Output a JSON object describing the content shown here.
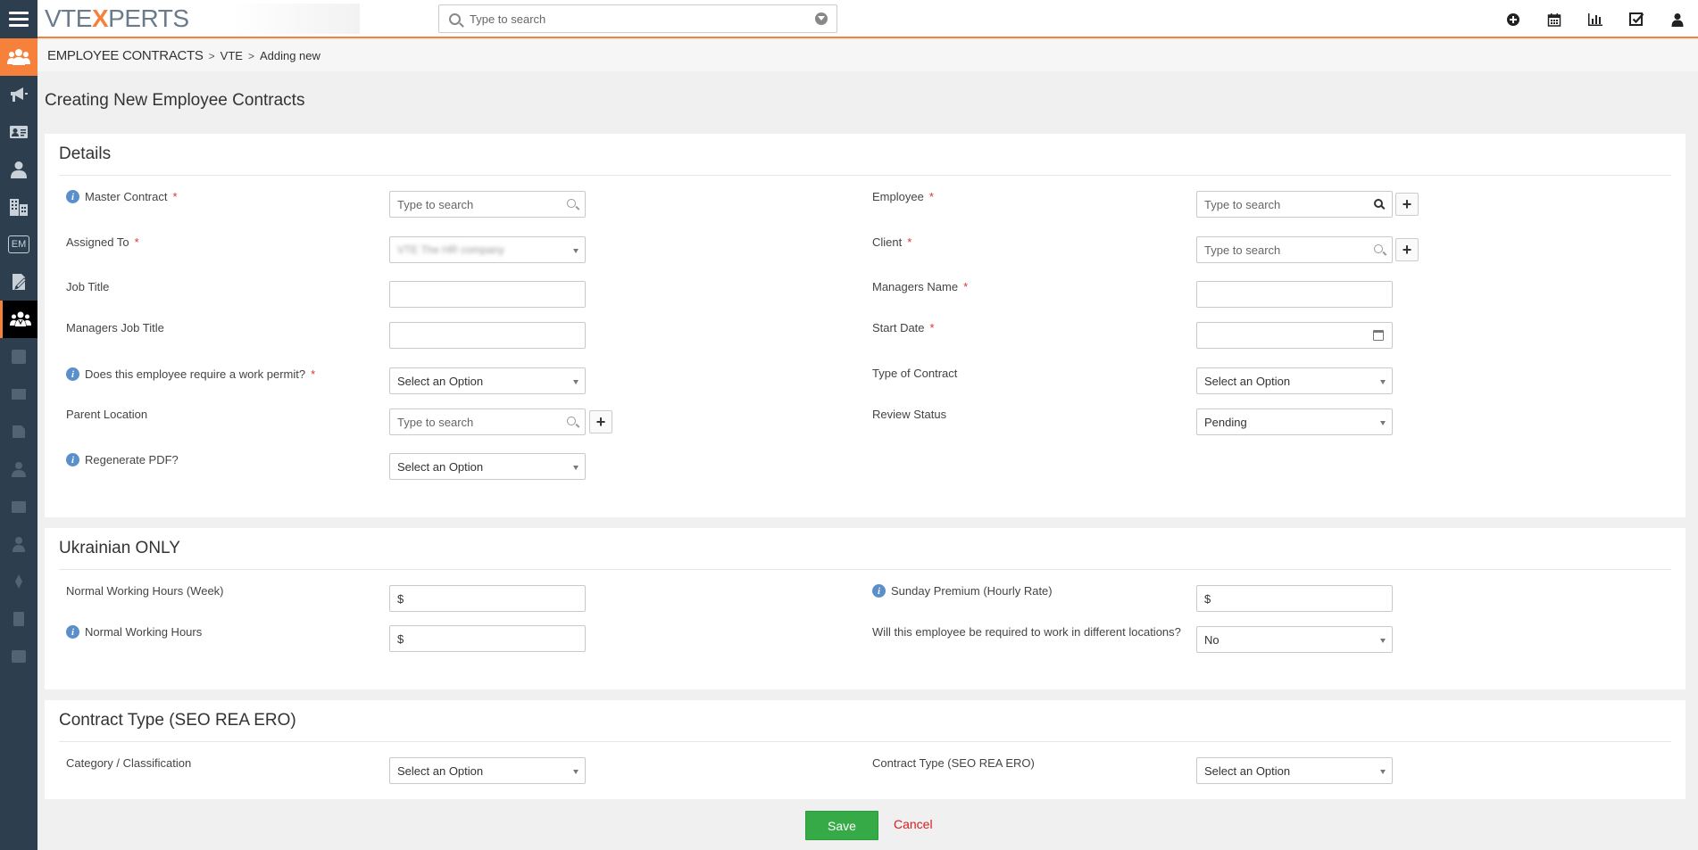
{
  "app": {
    "logo_prefix": "VTE",
    "logo_x": "X",
    "logo_suffix": "PERTS"
  },
  "search": {
    "placeholder": "Type to search"
  },
  "top_icons": [
    "add-icon",
    "calendar-icon",
    "reports-icon",
    "tasks-icon",
    "user-icon"
  ],
  "sidebar": {
    "items": [
      "users-group-icon",
      "megaphone-icon",
      "contact-card-icon",
      "person-icon",
      "building-icon",
      "EM",
      "document-icon",
      "employee-contracts-icon"
    ]
  },
  "breadcrumb": {
    "module": "EMPLOYEE CONTRACTS",
    "sep1": ">",
    "item1": "VTE",
    "sep2": ">",
    "item2": "Adding new"
  },
  "page_title": "Creating New Employee Contracts",
  "details": {
    "title": "Details",
    "master_contract": {
      "label": "Master Contract",
      "placeholder": "Type to search"
    },
    "employee": {
      "label": "Employee",
      "placeholder": "Type to search"
    },
    "assigned_to": {
      "label": "Assigned To",
      "value": "VTE The HR company"
    },
    "client": {
      "label": "Client",
      "placeholder": "Type to search"
    },
    "job_title": {
      "label": "Job Title",
      "value": ""
    },
    "managers_name": {
      "label": "Managers Name",
      "value": ""
    },
    "managers_job_title": {
      "label": "Managers Job Title",
      "value": ""
    },
    "start_date": {
      "label": "Start Date",
      "value": ""
    },
    "work_permit": {
      "label": "Does this employee require a work permit?",
      "value": "Select an Option"
    },
    "type_of_contract": {
      "label": "Type of Contract",
      "value": "Select an Option"
    },
    "parent_location": {
      "label": "Parent Location",
      "placeholder": "Type to search"
    },
    "review_status": {
      "label": "Review Status",
      "value": "Pending"
    },
    "regenerate_pdf": {
      "label": "Regenerate PDF?",
      "value": "Select an Option"
    }
  },
  "ukrainian": {
    "title": "Ukrainian ONLY",
    "normal_hours_week": {
      "label": "Normal Working Hours (Week)",
      "value": "$"
    },
    "sunday_premium": {
      "label": "Sunday Premium (Hourly Rate)",
      "value": "$"
    },
    "normal_hours": {
      "label": "Normal Working Hours",
      "value": "$"
    },
    "different_locations": {
      "label": "Will this employee be required to work in different locations?",
      "value": "No"
    }
  },
  "contract_type": {
    "title": "Contract Type (SEO REA ERO)",
    "category": {
      "label": "Category / Classification",
      "value": "Select an Option"
    },
    "contract_type_field": {
      "label": "Contract Type (SEO REA ERO)",
      "value": "Select an Option"
    }
  },
  "footer": {
    "save_label": "Save",
    "cancel_label": "Cancel"
  },
  "colors": {
    "accent": "#f5813b",
    "sidebar": "#2d3e4e",
    "save": "#35aa47",
    "cancel": "#d21e1e",
    "required": "#dd3333",
    "info": "#5a8fc9"
  }
}
